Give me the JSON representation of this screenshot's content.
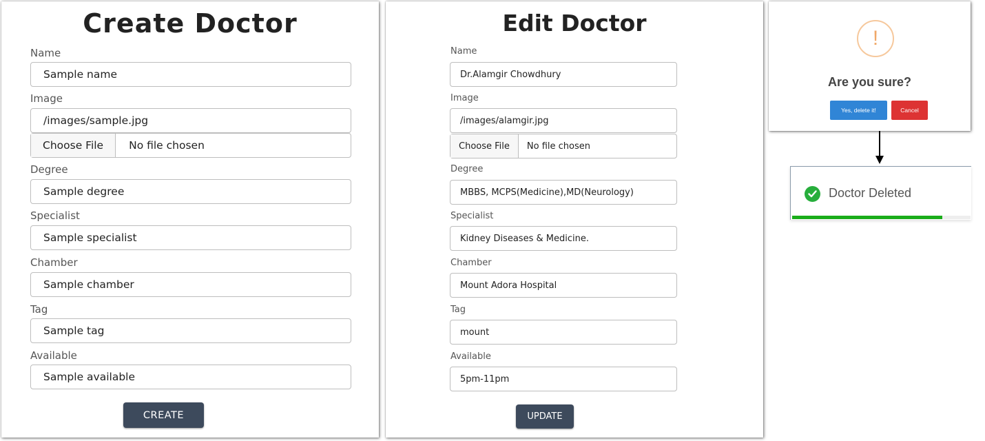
{
  "create_form": {
    "title": "Create Doctor",
    "name_label": "Name",
    "name_value": "Sample name",
    "image_label": "Image",
    "image_value": "/images/sample.jpg",
    "file_button": "Choose File",
    "file_status": "No file chosen",
    "degree_label": "Degree",
    "degree_value": "Sample degree",
    "specialist_label": "Specialist",
    "specialist_value": "Sample specialist",
    "chamber_label": "Chamber",
    "chamber_value": "Sample chamber",
    "tag_label": "Tag",
    "tag_value": "Sample tag",
    "available_label": "Available",
    "available_value": "Sample available",
    "submit_label": "CREATE"
  },
  "edit_form": {
    "title": "Edit Doctor",
    "name_label": "Name",
    "name_value": "Dr.Alamgir Chowdhury",
    "image_label": "Image",
    "image_value": "/images/alamgir.jpg",
    "file_button": "Choose File",
    "file_status": "No file chosen",
    "degree_label": "Degree",
    "degree_value": "MBBS, MCPS(Medicine),MD(Neurology)",
    "specialist_label": "Specialist",
    "specialist_value": "Kidney Diseases & Medicine.",
    "chamber_label": "Chamber",
    "chamber_value": "Mount Adora Hospital",
    "tag_label": "Tag",
    "tag_value": "mount",
    "available_label": "Available",
    "available_value": "5pm-11pm",
    "submit_label": "UPDATE"
  },
  "confirm_dialog": {
    "icon": "!",
    "title": "Are you sure?",
    "confirm_label": "Yes, delete it!",
    "cancel_label": "Cancel"
  },
  "toast": {
    "message": "Doctor Deleted",
    "icon": "check-circle-icon",
    "progress": 0.84
  },
  "colors": {
    "button_dark": "#3d4a5c",
    "confirm_blue": "#3085d6",
    "cancel_red": "#dd3333",
    "warning_orange": "#f0a868",
    "success_green": "#27ae3c"
  }
}
